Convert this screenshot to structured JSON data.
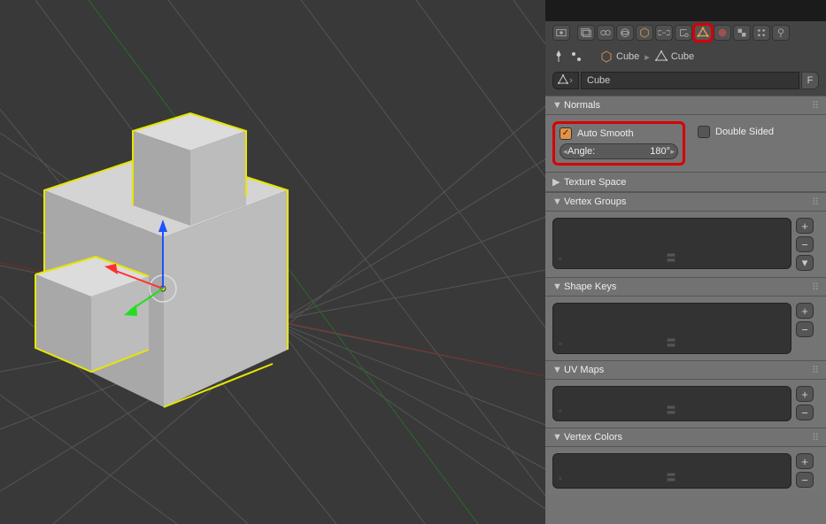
{
  "breadcrumb": {
    "item1": "Cube",
    "item2": "Cube"
  },
  "object_name": "Cube",
  "f_button": "F",
  "panels": {
    "normals": "Normals",
    "auto_smooth": "Auto Smooth",
    "angle_label": "Angle:",
    "angle_value": "180°",
    "double_sided": "Double Sided",
    "texture_space": "Texture Space",
    "vertex_groups": "Vertex Groups",
    "shape_keys": "Shape Keys",
    "uv_maps": "UV Maps",
    "vertex_colors": "Vertex Colors"
  }
}
